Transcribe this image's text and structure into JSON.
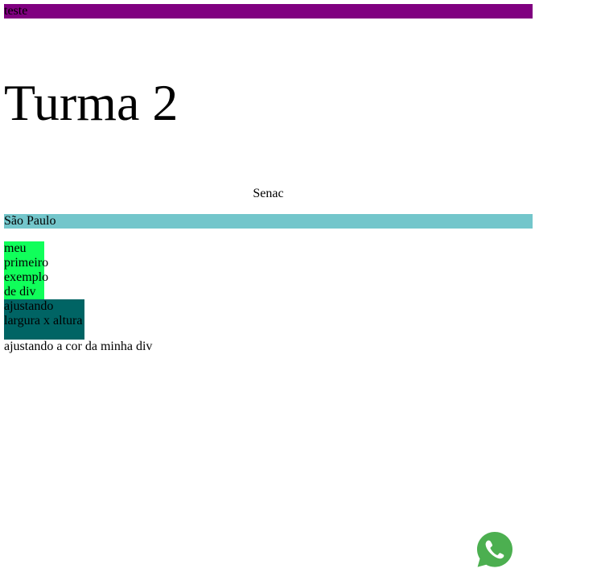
{
  "top_bar": {
    "text": "teste",
    "color": "#800080"
  },
  "heading": {
    "text": "Turma 2"
  },
  "center_line": {
    "text": "Senac"
  },
  "city_bar": {
    "text": "São Paulo",
    "color": "#73c6cb"
  },
  "green_box": {
    "color": "#10ff5a",
    "lines": [
      "meu",
      "primeiro",
      "exemplo",
      "de div"
    ]
  },
  "teal_box": {
    "color": "#006464",
    "lines": [
      "ajustando",
      "largura x altura"
    ]
  },
  "plain_line": {
    "text": "ajustando a cor da minha div"
  },
  "whatsapp": {
    "icon": "whatsapp-icon",
    "color": "#4caf50"
  }
}
